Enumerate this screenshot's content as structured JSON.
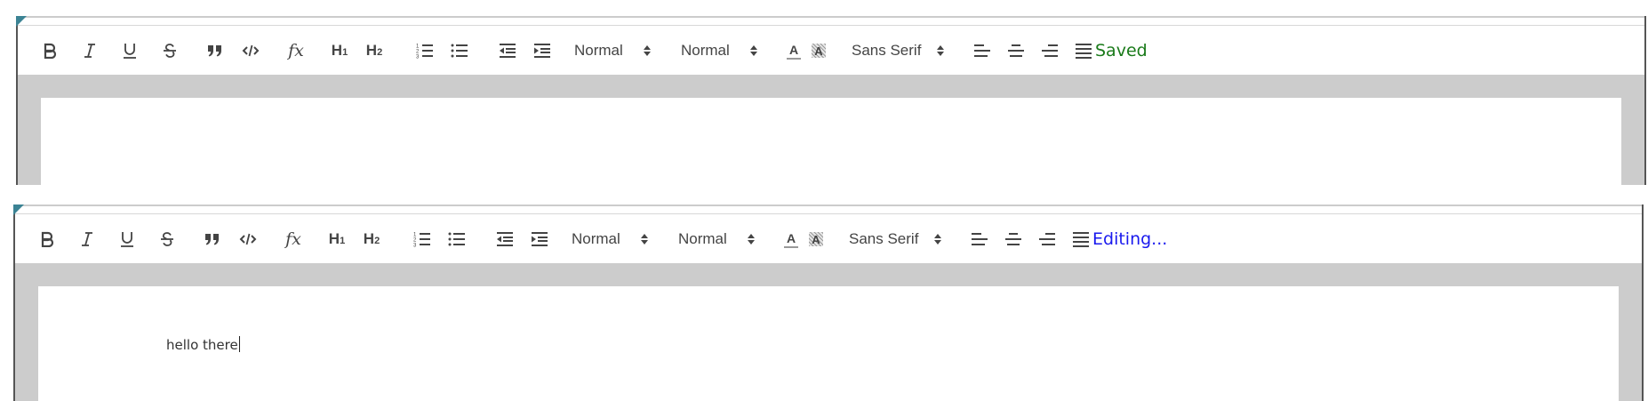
{
  "editors": [
    {
      "status": "Saved",
      "status_color": "#1a7a1a",
      "content_text": ""
    },
    {
      "status": "Editing...",
      "status_color": "#1a1aee",
      "content_text": "hello there"
    }
  ],
  "toolbar": {
    "header1_label": "H",
    "header1_sub": "1",
    "header2_label": "H",
    "header2_sub": "2",
    "size_label": "Normal",
    "header_label": "Normal",
    "font_label": "Sans Serif",
    "color_glyph": "A",
    "background_glyph": "A",
    "formula_glyph": "fx"
  },
  "icons": [
    "bold-icon",
    "italic-icon",
    "underline-icon",
    "strikethrough-icon",
    "blockquote-icon",
    "code-block-icon",
    "formula-icon",
    "header-1-icon",
    "header-2-icon",
    "ordered-list-icon",
    "bullet-list-icon",
    "outdent-icon",
    "indent-icon",
    "font-color-icon",
    "background-color-icon",
    "align-left-icon",
    "align-center-icon",
    "align-right-icon",
    "align-justify-icon"
  ],
  "accent_colors": {
    "corner": "#3b8394",
    "grey": "#cccccc",
    "icon": "#444444"
  }
}
